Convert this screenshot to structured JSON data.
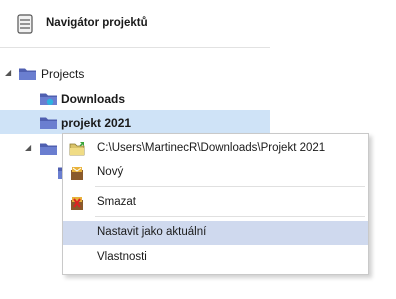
{
  "panel": {
    "title": "Navigátor projektů",
    "icon": "project-navigator-icon"
  },
  "tree": {
    "root": {
      "label": "Projects",
      "expanded": true,
      "icon": "folder-icon"
    },
    "items": [
      {
        "label": "Downloads",
        "bold": true,
        "icon": "folder-download-icon"
      },
      {
        "label": "projekt 2021",
        "bold": true,
        "selected": true,
        "icon": "folder-icon"
      }
    ]
  },
  "context_menu": {
    "items": [
      {
        "label": "C:\\Users\\MartinecR\\Downloads\\Projekt 2021",
        "icon": "open-folder-icon"
      },
      {
        "label": "Nový",
        "icon": "new-icon"
      },
      {
        "label": "Smazat",
        "icon": "delete-icon"
      },
      {
        "label": "Nastavit jako aktuální",
        "highlighted": true
      },
      {
        "label": "Vlastnosti"
      }
    ]
  },
  "colors": {
    "selection": "#cfe3f7",
    "menu_highlight": "#cfd9ee",
    "folder": "#4f5fb0"
  }
}
